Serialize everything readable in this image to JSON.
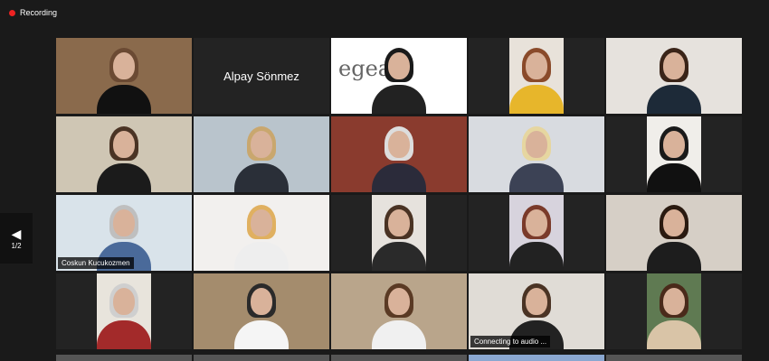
{
  "recording": {
    "label": "Recording"
  },
  "pager": {
    "indicator": "1/2"
  },
  "participants": [
    {
      "id": "p1",
      "hair": "#6b4a33",
      "body": "#111",
      "bg": "#8a6a4c"
    },
    {
      "id": "p2",
      "name_only": "Alpay Sönmez"
    },
    {
      "id": "p3",
      "hair": "#1a1a1a",
      "body": "#222",
      "bg": "#ffffff",
      "logo": "egead"
    },
    {
      "id": "p4",
      "hair": "#8a4a2a",
      "body": "#e7b62b",
      "bg": "#e8e2da"
    },
    {
      "id": "p5",
      "hair": "#3a2418",
      "body": "#1d2a38",
      "bg": "#e6e2dd"
    },
    {
      "id": "p6",
      "hair": "#4a3324",
      "body": "#1b1b1b",
      "bg": "#cfc6b4"
    },
    {
      "id": "p7",
      "hair": "#c9a76e",
      "body": "#2a2f38",
      "bg": "#b9c4cc"
    },
    {
      "id": "p8",
      "hair": "#ddd",
      "body": "#2b2b3a",
      "bg": "#8a3b2e"
    },
    {
      "id": "p9",
      "hair": "#e6d6a0",
      "body": "#3c4255",
      "bg": "#d8dbe0"
    },
    {
      "id": "p10",
      "hair": "#1a1a1a",
      "body": "#111",
      "bg": "#f0eeea"
    },
    {
      "id": "p11",
      "hair": "#bfbfbf",
      "body": "#4a6a9a",
      "bg": "#d9e3ea",
      "label": "Coskun Kucukozmen",
      "active": true
    },
    {
      "id": "p12",
      "hair": "#e0b060",
      "body": "#eee",
      "bg": "#f2f0ee"
    },
    {
      "id": "p13",
      "hair": "#4a3324",
      "body": "#2a2a2a",
      "bg": "#e6e2dd"
    },
    {
      "id": "p14",
      "hair": "#7a3a2a",
      "body": "#222",
      "bg": "#d7d3dd"
    },
    {
      "id": "p15",
      "hair": "#2a1a10",
      "body": "#1d1d1d",
      "bg": "#d6cfc6"
    },
    {
      "id": "p16",
      "hair": "#cfcfcf",
      "body": "#a32a2a",
      "bg": "#e8e4dc"
    },
    {
      "id": "p17",
      "hair": "#2a2a2a",
      "body": "#f5f5f5",
      "bg": "#a48c6d"
    },
    {
      "id": "p18",
      "hair": "#5a3a24",
      "body": "#f0f0f0",
      "bg": "#b9a58b"
    },
    {
      "id": "p19",
      "hair": "#4a3324",
      "body": "#222",
      "bg": "#e0dcd6",
      "label": "Connecting to audio ..."
    },
    {
      "id": "p20",
      "hair": "#4a2a1a",
      "body": "#d9c4a7",
      "bg": "#5f7a52"
    }
  ]
}
